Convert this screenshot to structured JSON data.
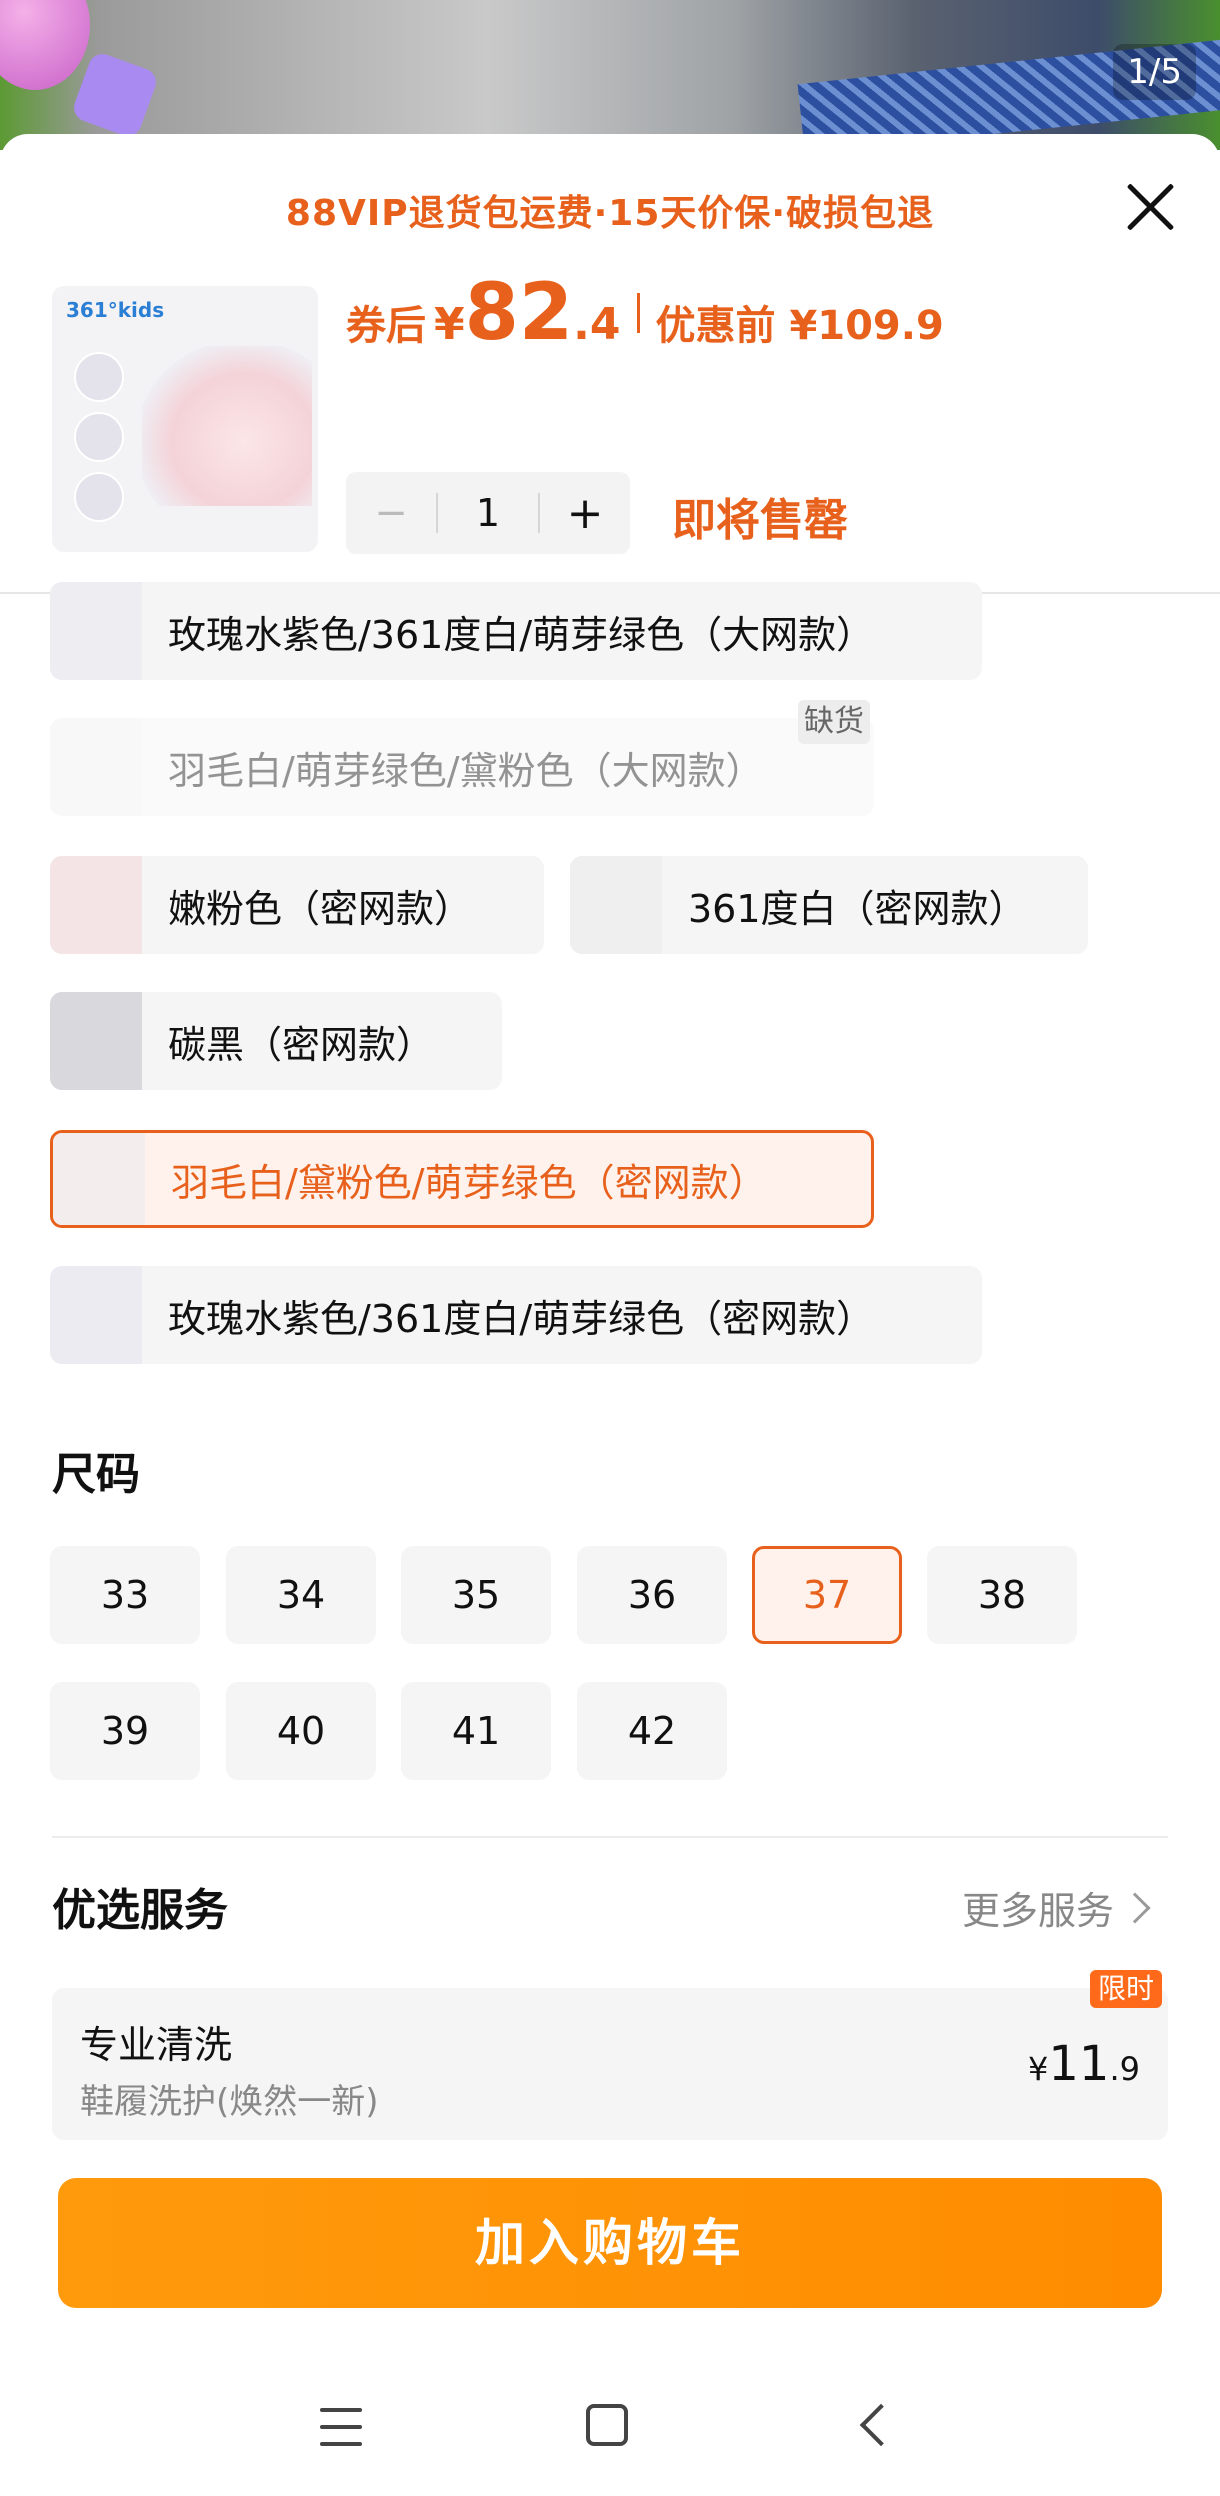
{
  "gallery": {
    "page_indicator": "1/5"
  },
  "promo_banner": "88VIP退货包运费·15天价保·破损包退",
  "product": {
    "thumb_brand": "361°kids",
    "price": {
      "after_label": "券后",
      "currency": "¥",
      "integer": "82",
      "decimal": ".4",
      "before_label": "优惠前 ¥109.9"
    },
    "quantity": {
      "minus": "−",
      "value": "1",
      "plus": "+"
    },
    "status": "即将售罄"
  },
  "colors": {
    "options": [
      {
        "label": "玫瑰水紫色/361度白/萌芽绿色（大网款）",
        "state": "normal"
      },
      {
        "label": "羽毛白/萌芽绿色/黛粉色（大网款）",
        "state": "disabled"
      },
      {
        "label": "嫩粉色（密网款）",
        "state": "normal"
      },
      {
        "label": "361度白（密网款）",
        "state": "normal"
      },
      {
        "label": "碳黑（密网款）",
        "state": "normal"
      },
      {
        "label": "羽毛白/黛粉色/萌芽绿色（密网款）",
        "state": "selected"
      },
      {
        "label": "玫瑰水紫色/361度白/萌芽绿色（密网款）",
        "state": "normal"
      }
    ],
    "out_of_stock_tag": "缺货"
  },
  "sizes": {
    "title": "尺码",
    "options": [
      "33",
      "34",
      "35",
      "36",
      "37",
      "38",
      "39",
      "40",
      "41",
      "42"
    ],
    "selected": "37"
  },
  "services": {
    "title": "优选服务",
    "more_label": "更多服务",
    "card": {
      "name": "专业清洗",
      "desc": "鞋履洗护(焕然一新)",
      "price_currency": "¥",
      "price_integer": "11",
      "price_decimal": ".9",
      "tag": "限时"
    }
  },
  "cart_button": "加入购物车",
  "colors_palette": {
    "accent": "#e8611c",
    "button": "#ff8c00",
    "option_bg": "#f5f5f5"
  }
}
